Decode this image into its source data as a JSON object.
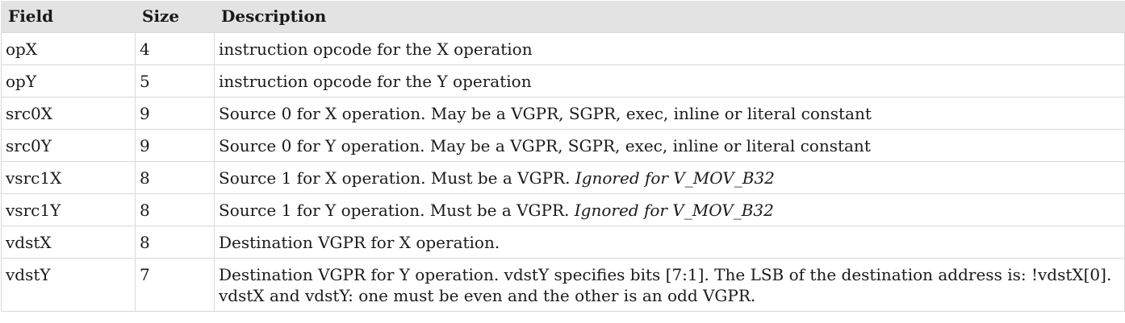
{
  "table": {
    "headers": {
      "field": "Field",
      "size": "Size",
      "description": "Description"
    },
    "rows": [
      {
        "field": "opX",
        "size": "4",
        "desc": "instruction opcode for the X operation",
        "note": ""
      },
      {
        "field": "opY",
        "size": "5",
        "desc": "instruction opcode for the Y operation",
        "note": ""
      },
      {
        "field": "src0X",
        "size": "9",
        "desc": "Source 0 for X operation. May be a VGPR, SGPR, exec, inline or literal constant",
        "note": ""
      },
      {
        "field": "src0Y",
        "size": "9",
        "desc": "Source 0 for Y operation. May be a VGPR, SGPR, exec, inline or literal constant",
        "note": ""
      },
      {
        "field": "vsrc1X",
        "size": "8",
        "desc": "Source 1 for X operation. Must be a VGPR. ",
        "note": "Ignored for V_MOV_B32"
      },
      {
        "field": "vsrc1Y",
        "size": "8",
        "desc": "Source 1 for Y operation. Must be a VGPR. ",
        "note": "Ignored for V_MOV_B32"
      },
      {
        "field": "vdstX",
        "size": "8",
        "desc": "Destination VGPR for X operation.",
        "note": ""
      },
      {
        "field": "vdstY",
        "size": "7",
        "desc": "Destination VGPR for Y operation. vdstY specifies bits [7:1]. The LSB of the destination address is: !vdstX[0]. vdstX and vdstY: one must be even and the other is an odd VGPR.",
        "note": ""
      }
    ]
  }
}
